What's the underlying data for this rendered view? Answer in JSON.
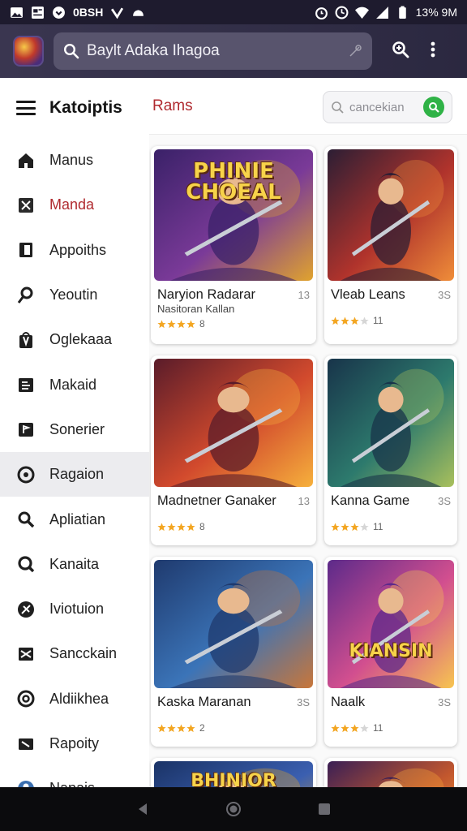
{
  "status_bar": {
    "carrier": "0BSH",
    "time": "13% 9M",
    "icons": [
      "photo-icon",
      "news-icon",
      "pocket-icon",
      "check-icon",
      "cloud-icon",
      "alarm-icon",
      "clock-icon",
      "wifi-icon",
      "signal-icon",
      "battery-icon"
    ]
  },
  "app_bar": {
    "search_text": "Baylt Adaka Ihagoa",
    "actions": [
      "search-plus-icon",
      "more-vert-icon"
    ]
  },
  "sidebar": {
    "title": "Katoiptis",
    "items": [
      {
        "label": "Manus",
        "icon": "home-icon"
      },
      {
        "label": "Manda",
        "icon": "close-box-icon"
      },
      {
        "label": "Appoiths",
        "icon": "square-outline-icon"
      },
      {
        "label": "Yeoutin",
        "icon": "pin-icon"
      },
      {
        "label": "Oglekaaa",
        "icon": "bag-icon"
      },
      {
        "label": "Makaid",
        "icon": "document-icon"
      },
      {
        "label": "Sonerier",
        "icon": "flag-icon"
      },
      {
        "label": "Ragaion",
        "icon": "circle-icon"
      },
      {
        "label": "Apliatian",
        "icon": "search-zoom-icon"
      },
      {
        "label": "Kanaita",
        "icon": "search-icon"
      },
      {
        "label": "Iviotuion",
        "icon": "compass-icon"
      },
      {
        "label": "Sancckain",
        "icon": "shuffle-icon"
      },
      {
        "label": "Aldiikhea",
        "icon": "at-icon"
      },
      {
        "label": "Rapoity",
        "icon": "slash-icon"
      },
      {
        "label": "Nanais",
        "icon": "user-circle-icon"
      }
    ],
    "active_index": 1,
    "selected_index": 7
  },
  "main": {
    "title": "Rams",
    "filter_placeholder": "cancekian",
    "cards": [
      {
        "title": "Naryion Radarar",
        "subtitle": "Nasitoran Kallan",
        "meta": "13",
        "rating": 4,
        "count": "8",
        "art_text": "PHINIE CHOEAL",
        "colors": [
          "#3a2168",
          "#7a3a98",
          "#e0a32e"
        ]
      },
      {
        "title": "Vleab Leans",
        "subtitle": "",
        "meta": "3S",
        "rating": 3,
        "count": "11",
        "art_text": "",
        "colors": [
          "#2c1e34",
          "#b0332c",
          "#ef8d39"
        ]
      },
      {
        "title": "Madnetner Ganaker",
        "subtitle": "",
        "meta": "13",
        "rating": 4,
        "count": "8",
        "art_text": "",
        "colors": [
          "#5a1c2a",
          "#d24a2d",
          "#f6b03c"
        ]
      },
      {
        "title": "Kanna Game",
        "subtitle": "",
        "meta": "3S",
        "rating": 3,
        "count": "11",
        "art_text": "",
        "colors": [
          "#18344a",
          "#2d7a6d",
          "#a9c05c"
        ]
      },
      {
        "title": "Kaska Maranan",
        "subtitle": "",
        "meta": "3S",
        "rating": 4,
        "count": "2",
        "art_text": "",
        "colors": [
          "#1f3a6e",
          "#3b74b8",
          "#c8763a"
        ]
      },
      {
        "title": "Naalk",
        "subtitle": "",
        "meta": "3S",
        "rating": 3,
        "count": "11",
        "art_text": "KIANSIN",
        "colors": [
          "#5c2a8a",
          "#d24f8f",
          "#f7c550"
        ]
      },
      {
        "title": "",
        "subtitle": "",
        "meta": "",
        "rating": 0,
        "count": "",
        "art_text": "BHINIOR",
        "colors": [
          "#1a3366",
          "#3b5fb0",
          "#e0a32e"
        ]
      },
      {
        "title": "",
        "subtitle": "",
        "meta": "",
        "rating": 0,
        "count": "",
        "art_text": "",
        "colors": [
          "#3a1f55",
          "#c2572e",
          "#f5a63a"
        ]
      }
    ]
  },
  "nav_bar": {
    "buttons": [
      "back-icon",
      "home-circle-icon",
      "recents-icon"
    ]
  }
}
